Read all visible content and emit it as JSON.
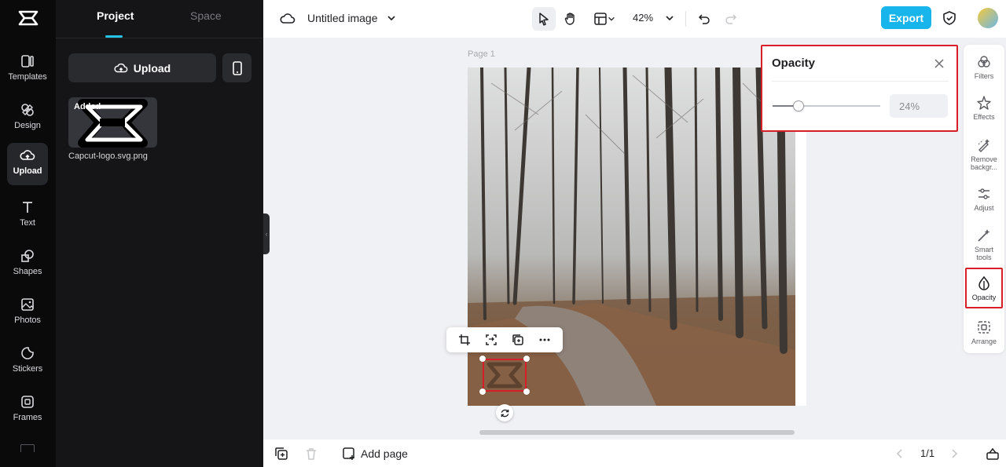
{
  "rail": {
    "items": [
      {
        "label": "Templates",
        "icon": "templates-icon"
      },
      {
        "label": "Design",
        "icon": "design-icon"
      },
      {
        "label": "Upload",
        "icon": "upload-cloud-icon"
      },
      {
        "label": "Text",
        "icon": "text-icon"
      },
      {
        "label": "Shapes",
        "icon": "shapes-icon"
      },
      {
        "label": "Photos",
        "icon": "photos-icon"
      },
      {
        "label": "Stickers",
        "icon": "stickers-icon"
      },
      {
        "label": "Frames",
        "icon": "frames-icon"
      }
    ],
    "active": "Upload"
  },
  "panel": {
    "tabs": [
      {
        "label": "Project"
      },
      {
        "label": "Space"
      }
    ],
    "active_tab": "Project",
    "upload_label": "Upload",
    "asset": {
      "badge": "Added",
      "name": "Capcut-logo.svg.png"
    }
  },
  "topbar": {
    "doc_title": "Untitled image",
    "zoom": "42%",
    "export_label": "Export"
  },
  "canvas": {
    "page_label": "Page 1"
  },
  "opacity_popup": {
    "title": "Opacity",
    "value": 24,
    "value_text": "24%"
  },
  "right_tools": {
    "items": [
      {
        "label": "Filters"
      },
      {
        "label": "Effects"
      },
      {
        "label": "Remove backgr..."
      },
      {
        "label": "Adjust"
      },
      {
        "label": "Smart tools"
      },
      {
        "label": "Opacity"
      },
      {
        "label": "Arrange"
      }
    ],
    "active": "Opacity"
  },
  "bottombar": {
    "add_page_label": "Add page",
    "pager": "1/1"
  },
  "colors": {
    "accent": "#18b4ec",
    "highlight": "#d81e28",
    "tab_underline": "#27c3e6"
  }
}
